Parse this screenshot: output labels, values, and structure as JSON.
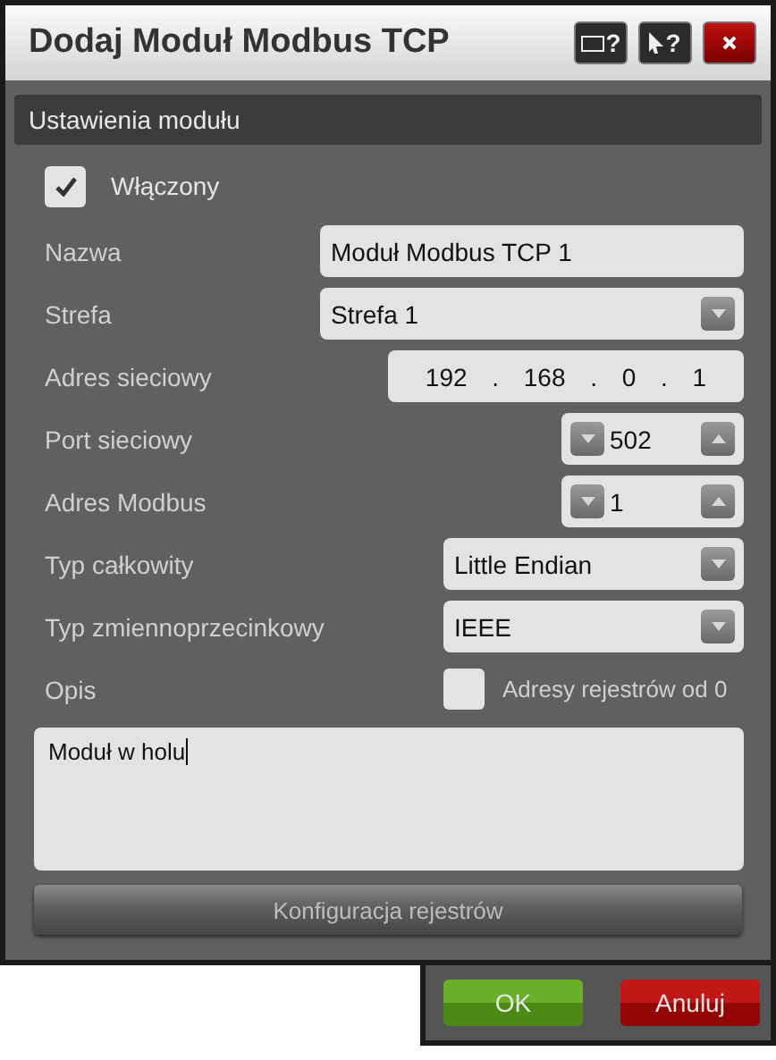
{
  "window": {
    "title": "Dodaj Moduł Modbus TCP"
  },
  "title_buttons": [
    {
      "kind": "window-help",
      "label": "?"
    },
    {
      "kind": "pointer-help",
      "label": "?"
    },
    {
      "kind": "close"
    }
  ],
  "section": {
    "title": "Ustawienia modułu"
  },
  "enabled": {
    "label": "Włączony",
    "checked": true
  },
  "fields": [
    {
      "kind": "text",
      "label": "Nazwa",
      "value": "Moduł Modbus TCP 1"
    },
    {
      "kind": "select",
      "label": "Strefa",
      "value": "Strefa 1"
    },
    {
      "kind": "ip",
      "label": "Adres sieciowy",
      "octets": [
        "192",
        "168",
        "0",
        "1"
      ],
      "separator": "."
    },
    {
      "kind": "spinner",
      "label": "Port sieciowy",
      "value": "502"
    },
    {
      "kind": "spinner",
      "label": "Adres Modbus",
      "value": "1"
    },
    {
      "kind": "select",
      "label": "Typ całkowity",
      "value": "Little Endian"
    },
    {
      "kind": "select",
      "label": "Typ zmiennoprzecinkowy",
      "value": "IEEE"
    },
    {
      "kind": "checkbox",
      "label": "Opis",
      "option": "Adresy rejestrów od 0",
      "checked": false
    }
  ],
  "description": {
    "value": "Moduł w holu"
  },
  "config_button": {
    "label": "Konfiguracja rejestrów",
    "disabled": true
  },
  "buttons": [
    {
      "kind": "ok",
      "label": "OK"
    },
    {
      "kind": "cancel",
      "label": "Anuluj"
    }
  ]
}
